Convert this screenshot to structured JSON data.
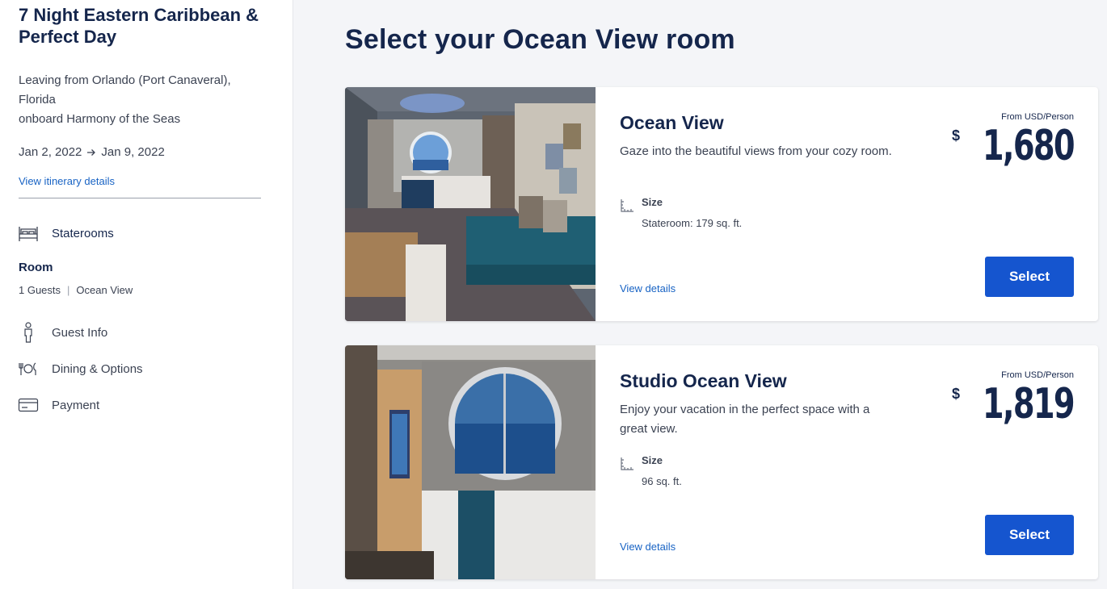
{
  "sidebar": {
    "trip_title": "7 Night Eastern Caribbean & Perfect Day",
    "leaving_line1": "Leaving from Orlando (Port Canaveral), Florida",
    "leaving_line2": "onboard Harmony of the Seas",
    "date_start": "Jan 2, 2022",
    "date_end": "Jan 9, 2022",
    "itinerary_link": "View itinerary details",
    "steps": {
      "staterooms": "Staterooms",
      "room_heading": "Room",
      "guests": "1 Guests",
      "room_type": "Ocean View",
      "guest_info": "Guest Info",
      "dining": "Dining & Options",
      "payment": "Payment"
    }
  },
  "main": {
    "title": "Select your Ocean View room",
    "rooms": [
      {
        "name": "Ocean View",
        "description": "Gaze into the beautiful views from your cozy room.",
        "size_label": "Size",
        "size_value": "Stateroom: 179 sq. ft.",
        "view_details": "View details",
        "price_label": "From USD/Person",
        "currency": "$",
        "price": "1,680",
        "select_label": "Select"
      },
      {
        "name": "Studio Ocean View",
        "description": "Enjoy your vacation in the perfect space with a great view.",
        "size_label": "Size",
        "size_value": "96 sq. ft.",
        "view_details": "View details",
        "price_label": "From USD/Person",
        "currency": "$",
        "price": "1,819",
        "select_label": "Select"
      }
    ]
  },
  "colors": {
    "navy": "#15264c",
    "link_blue": "#1863c4",
    "button_blue": "#1555cf"
  }
}
